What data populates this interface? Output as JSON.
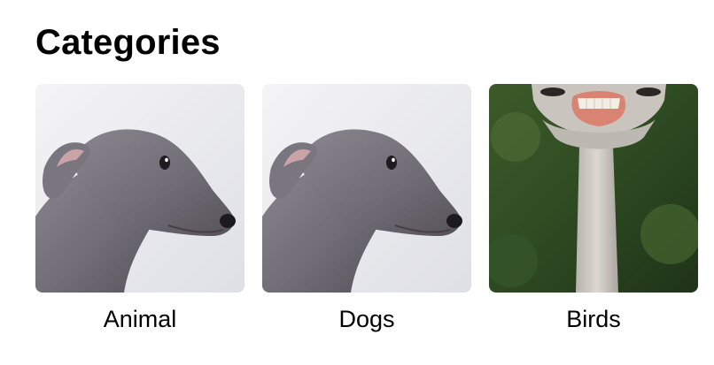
{
  "header": {
    "title": "Categories"
  },
  "categories": [
    {
      "label": "Animal",
      "image": "greyhound-dog-profile"
    },
    {
      "label": "Dogs",
      "image": "greyhound-dog-profile"
    },
    {
      "label": "Birds",
      "image": "ostrich-neck-with-teeth"
    }
  ],
  "colors": {
    "text": "#000000",
    "background": "#ffffff"
  }
}
